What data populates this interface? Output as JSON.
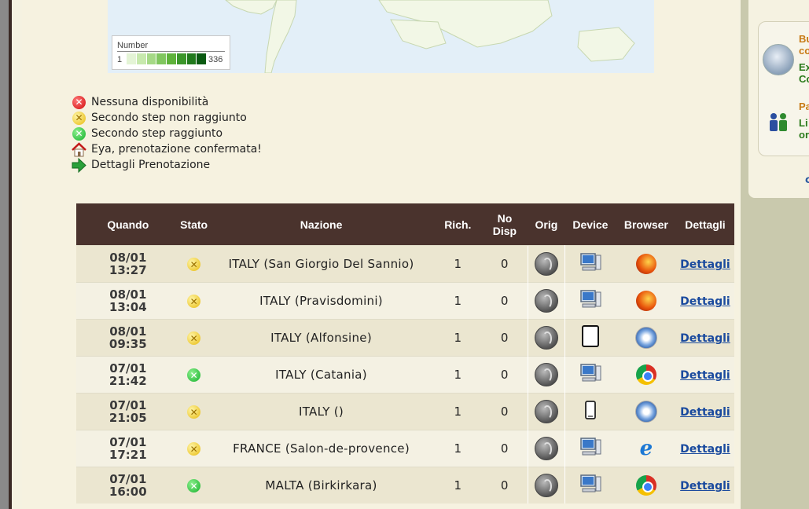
{
  "map": {
    "legend_title": "Number",
    "legend_min": "1",
    "legend_max": "336",
    "scale_colors": [
      "#e4f4d6",
      "#c7e9ad",
      "#a5d986",
      "#80c65e",
      "#5eb23a",
      "#3b962a",
      "#217a1d",
      "#0b5a12"
    ]
  },
  "status_legend": [
    {
      "icon": "red-x-icon",
      "label": "Nessuna disponibilità"
    },
    {
      "icon": "yellow-x-icon",
      "label": "Secondo step non raggiunto"
    },
    {
      "icon": "green-x-icon",
      "label": "Secondo step raggiunto"
    },
    {
      "icon": "house-icon",
      "label": "Eya, prenotazione confermata!"
    },
    {
      "icon": "arrow-right-icon",
      "label": "Dettagli Prenotazione"
    }
  ],
  "table": {
    "headers": {
      "when": "Quando",
      "status": "Stato",
      "nation": "Nazione",
      "requests": "Rich.",
      "not_avail_line1": "No",
      "not_avail_line2": "Disp",
      "orig": "Orig",
      "device": "Device",
      "browser": "Browser",
      "details": "Dettagli"
    },
    "rows": [
      {
        "date": "08/01",
        "time": "13:27",
        "status": "yellow",
        "nation": "ITALY (San Giorgio Del Sannio)",
        "requests": "1",
        "not_avail": "0",
        "device": "desktop",
        "browser": "firefox",
        "details": "Dettagli"
      },
      {
        "date": "08/01",
        "time": "13:04",
        "status": "yellow",
        "nation": "ITALY (Pravisdomini)",
        "requests": "1",
        "not_avail": "0",
        "device": "desktop",
        "browser": "firefox",
        "details": "Dettagli"
      },
      {
        "date": "08/01",
        "time": "09:35",
        "status": "yellow",
        "nation": "ITALY (Alfonsine)",
        "requests": "1",
        "not_avail": "0",
        "device": "tablet",
        "browser": "safari",
        "details": "Dettagli"
      },
      {
        "date": "07/01",
        "time": "21:42",
        "status": "green",
        "nation": "ITALY (Catania)",
        "requests": "1",
        "not_avail": "0",
        "device": "desktop",
        "browser": "chrome",
        "details": "Dettagli"
      },
      {
        "date": "07/01",
        "time": "21:05",
        "status": "yellow",
        "nation": "ITALY ()",
        "requests": "1",
        "not_avail": "0",
        "device": "phone",
        "browser": "safari",
        "details": "Dettagli"
      },
      {
        "date": "07/01",
        "time": "17:21",
        "status": "yellow",
        "nation": "FRANCE (Salon-de-provence)",
        "requests": "1",
        "not_avail": "0",
        "device": "desktop",
        "browser": "ie",
        "details": "Dettagli"
      },
      {
        "date": "07/01",
        "time": "16:00",
        "status": "green",
        "nation": "MALTA (Birkirkara)",
        "requests": "1",
        "not_avail": "0",
        "device": "desktop",
        "browser": "chrome",
        "details": "Dettagli"
      }
    ]
  },
  "sidebar": {
    "item1_line1": "Bu",
    "item1_line2": "co",
    "item1_line3": "Ex",
    "item1_line4": "Co",
    "item2_line1": "Pa",
    "item2_line2": "Li",
    "item2_line3": "or"
  },
  "colors": {
    "header_bg": "#4a332d",
    "link": "#1a4a9e",
    "sidebar_orange": "#c87a14",
    "sidebar_green": "#2a7a1a"
  }
}
